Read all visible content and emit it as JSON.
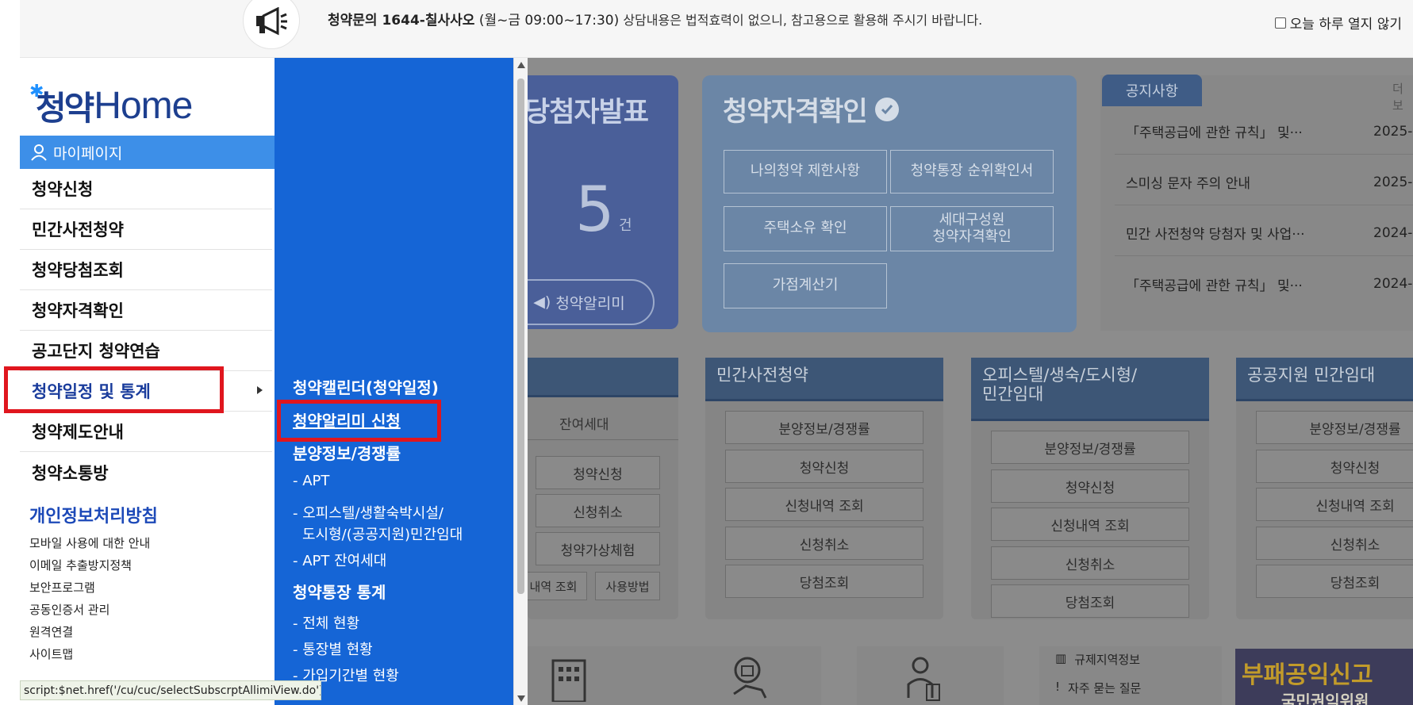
{
  "topbar": {
    "phone_label": "청약문의 1644-칠사사오",
    "hours": " (월~금 09:00~17:30)",
    "notice_rest": " 상담내용은 법적효력이 없으니, 참고용으로 활용해 주시기 바랍니다.",
    "hide_today": "오늘 하루 열지 않기"
  },
  "logo": {
    "korean": "청약",
    "english": "Home"
  },
  "sidebar": {
    "mypage": "마이페이지",
    "items": [
      {
        "label": "청약신청"
      },
      {
        "label": "민간사전청약"
      },
      {
        "label": "청약당첨조회"
      },
      {
        "label": "청약자격확인"
      },
      {
        "label": "공고단지 청약연습"
      },
      {
        "label": "청약일정 및 통계"
      },
      {
        "label": "청약제도안내"
      },
      {
        "label": "청약소통방"
      }
    ],
    "privacy": "개인정보처리방침",
    "links": [
      "모바일 사용에 대한 안내",
      "이메일 추출방지정책",
      "보안프로그램",
      "공동인증서 관리",
      "원격연결",
      "사이트맵"
    ]
  },
  "submenu": {
    "calendar": "청약캘린더(청약일정)",
    "allimi": "청약알리미 신청",
    "bunyang": "분양정보/경쟁률",
    "apt": "- APT",
    "officetel1": "- 오피스텔/생활숙박시설/",
    "officetel2": "도시형/(공공지원)민간임대",
    "apt_remain": "- APT 잔여세대",
    "stats": "청약통장 통계",
    "all_status": "- 전체 현황",
    "by_account": "- 통장별 현황",
    "by_period": "- 가입기간별 현황"
  },
  "main": {
    "winner_title": "당첨자발표",
    "winner_count": "5",
    "winner_unit": "건",
    "allimi_pill": "청약알리미",
    "qual_title": "청약자격확인",
    "qual_buttons": [
      "나의청약 제한사항",
      "청약통장 순위확인서",
      "주택소유 확인",
      "세대구성원\n청약자격확인",
      "가점계산기"
    ],
    "notice_tab": "공지사항",
    "notice_more": "더보",
    "notices": [
      {
        "title": "「주택공급에 관한 규칙」 및···",
        "date": "2025-"
      },
      {
        "title": "스미싱 문자 주의 안내",
        "date": "2025-"
      },
      {
        "title": "민간 사전청약 당첨자 및 사업···",
        "date": "2024-"
      },
      {
        "title": "「주택공급에 관한 규칙」 및···",
        "date": "2024-"
      }
    ],
    "col0": {
      "sub": "잔여세대",
      "buttons": [
        "청약신청",
        "신청취소",
        "청약가상체험"
      ],
      "small": [
        "내역 조회",
        "사용방법"
      ]
    },
    "col1": {
      "title": "민간사전청약",
      "buttons": [
        "분양정보/경쟁률",
        "청약신청",
        "신청내역 조회",
        "신청취소",
        "당첨조회"
      ]
    },
    "col2": {
      "title": "오피스텔/생숙/도시형/\n민간임대",
      "buttons": [
        "분양정보/경쟁률",
        "청약신청",
        "신청내역 조회",
        "신청취소",
        "당첨조회"
      ]
    },
    "col3": {
      "title": "공공지원 민간임대",
      "buttons": [
        "분양정보/경쟁률",
        "청약신청",
        "신청내역 조회",
        "신청취소",
        "당첨조회"
      ]
    },
    "bottom_links": [
      "규제지역정보",
      "자주 묻는 질문"
    ],
    "banner_a": "부패공익신고",
    "banner_b": "국민권익위원"
  },
  "status_bar": "script:$net.href('/cu/cuc/selectSubscrptAllimiView.do');"
}
